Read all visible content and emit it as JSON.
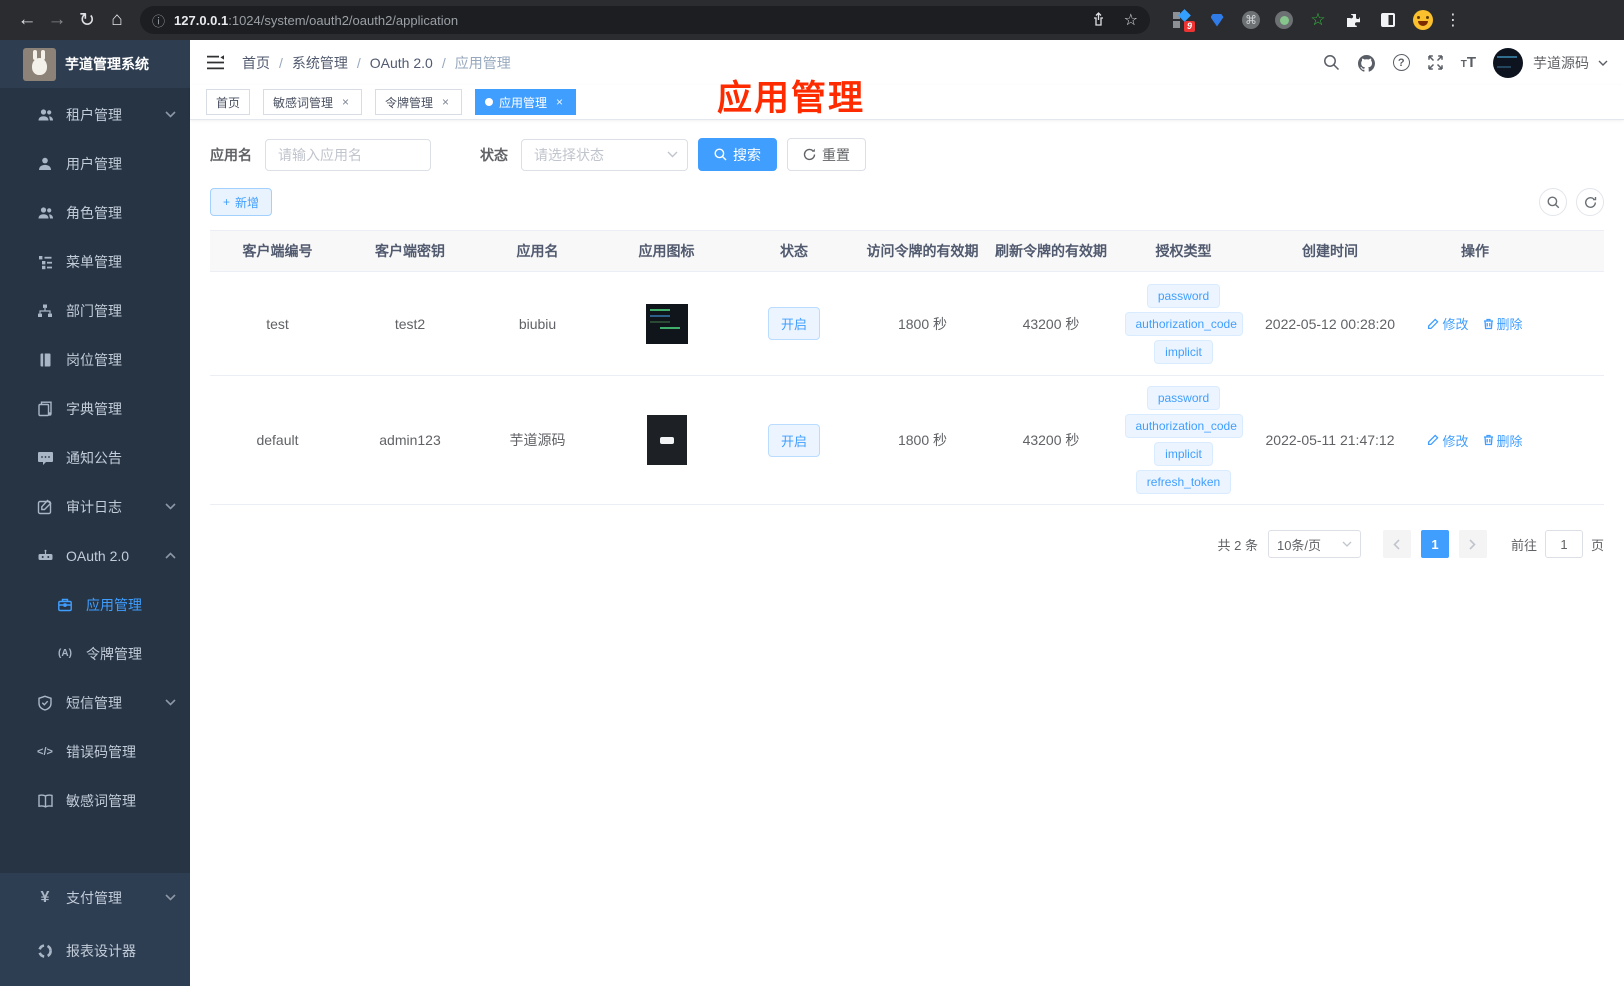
{
  "browser": {
    "url_host": "127.0.0.1",
    "url_rest": ":1024/system/oauth2/oauth2/application",
    "ext_badge": "9"
  },
  "icons": {
    "back": "←",
    "forward": "→",
    "reload": "↻",
    "home": "⌂",
    "info": "ⓘ",
    "star": "☆",
    "cmd": "⌘",
    "green_star": "☆",
    "menu_dots": "⋮",
    "question": "?",
    "font_small": "T",
    "font_large": "T",
    "yen": "¥",
    "code": "</>",
    "token": "(A)",
    "plus": "+",
    "close": "×",
    "slash": "/"
  },
  "sidebar": {
    "logo_title": "芋道管理系统",
    "items": [
      {
        "label": "租户管理"
      },
      {
        "label": "用户管理"
      },
      {
        "label": "角色管理"
      },
      {
        "label": "菜单管理"
      },
      {
        "label": "部门管理"
      },
      {
        "label": "岗位管理"
      },
      {
        "label": "字典管理"
      },
      {
        "label": "通知公告"
      },
      {
        "label": "审计日志"
      },
      {
        "label": "OAuth 2.0"
      },
      {
        "label": "应用管理"
      },
      {
        "label": "令牌管理"
      },
      {
        "label": "短信管理"
      },
      {
        "label": "错误码管理"
      },
      {
        "label": "敏感词管理"
      },
      {
        "label": "支付管理"
      },
      {
        "label": "报表设计器"
      }
    ]
  },
  "navbar": {
    "breadcrumb": [
      "首页",
      "系统管理",
      "OAuth 2.0",
      "应用管理"
    ],
    "username": "芋道源码"
  },
  "tabs": [
    {
      "label": "首页"
    },
    {
      "label": "敏感词管理"
    },
    {
      "label": "令牌管理"
    },
    {
      "label": "应用管理"
    }
  ],
  "annotation": {
    "text": "应用管理",
    "color": "#ff2b00"
  },
  "filter": {
    "name_label": "应用名",
    "name_placeholder": "请输入应用名",
    "status_label": "状态",
    "status_placeholder": "请选择状态",
    "search_label": "搜索",
    "reset_label": "重置",
    "add_label": "新增"
  },
  "table": {
    "headers": [
      "客户端编号",
      "客户端密钥",
      "应用名",
      "应用图标",
      "状态",
      "访问令牌的有效期",
      "刷新令牌的有效期",
      "授权类型",
      "创建时间",
      "操作"
    ],
    "edit_label": "修改",
    "delete_label": "删除",
    "rows": [
      {
        "client_id": "test",
        "client_secret": "test2",
        "app_name": "biubiu",
        "status": "开启",
        "access_validity": "1800 秒",
        "refresh_validity": "43200 秒",
        "grants": [
          "password",
          "authorization_code",
          "implicit"
        ],
        "created_at": "2022-05-12 00:28:20"
      },
      {
        "client_id": "default",
        "client_secret": "admin123",
        "app_name": "芋道源码",
        "status": "开启",
        "access_validity": "1800 秒",
        "refresh_validity": "43200 秒",
        "grants": [
          "password",
          "authorization_code",
          "implicit",
          "refresh_token"
        ],
        "created_at": "2022-05-11 21:47:12"
      }
    ]
  },
  "pagination": {
    "total": "共 2 条",
    "page_size": "10条/页",
    "current_page": "1",
    "goto_label": "前往",
    "goto_value": "1",
    "page_suffix": "页"
  }
}
